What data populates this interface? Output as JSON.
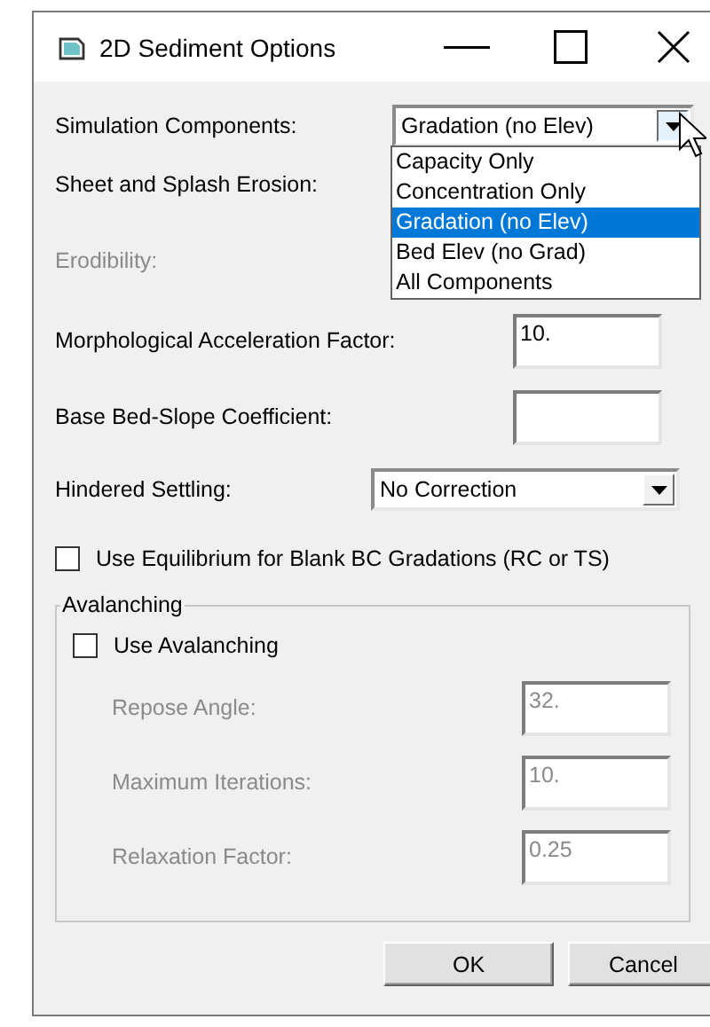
{
  "window": {
    "title": "2D Sediment Options"
  },
  "fields": [
    {
      "kind": "combo",
      "label": "Simulation Components:",
      "disabled": false,
      "value": "Gradation (no Elev)",
      "expanded": true,
      "options": [
        {
          "label": "Capacity Only",
          "selected": false
        },
        {
          "label": "Concentration Only",
          "selected": false
        },
        {
          "label": "Gradation (no Elev)",
          "selected": true
        },
        {
          "label": "Bed Elev (no Grad)",
          "selected": false
        },
        {
          "label": "All Components",
          "selected": false
        }
      ]
    },
    {
      "kind": "label",
      "label": "Sheet and Splash Erosion:",
      "disabled": false
    },
    {
      "kind": "label",
      "label": "Erodibility:",
      "disabled": true
    },
    {
      "kind": "text",
      "label": "Morphological Acceleration Factor:",
      "disabled": false,
      "value": "10."
    },
    {
      "kind": "text",
      "label": "Base Bed-Slope Coefficient:",
      "disabled": false
    },
    {
      "kind": "combo",
      "label": "Hindered Settling:",
      "disabled": false,
      "value": "No Correction",
      "expanded": false
    }
  ],
  "equilibrium": {
    "label": "Use Equilibrium for Blank BC Gradations (RC or TS)",
    "checked": false
  },
  "avalanching": {
    "legend": "Avalanching",
    "checkbox": {
      "label": "Use Avalanching",
      "checked": false
    },
    "fields": [
      {
        "label": "Repose Angle:",
        "value": "32.",
        "disabled": true
      },
      {
        "label": "Maximum Iterations:",
        "value": "10.",
        "disabled": true
      },
      {
        "label": "Relaxation Factor:",
        "value": "0.25",
        "disabled": true
      }
    ]
  },
  "buttons": [
    "OK",
    "Cancel"
  ]
}
